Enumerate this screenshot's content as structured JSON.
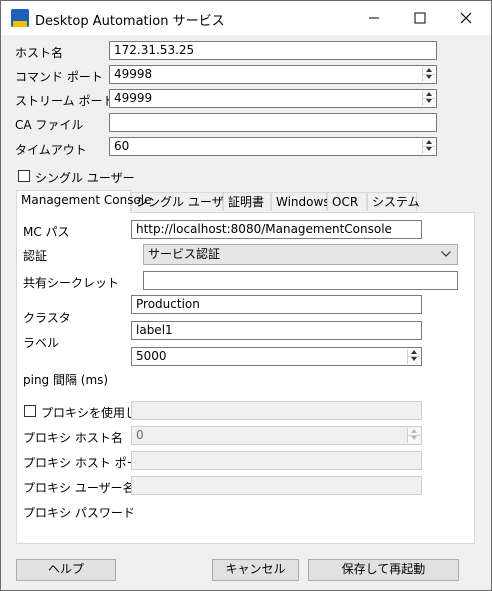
{
  "window": {
    "title": "Desktop Automation サービス"
  },
  "main": {
    "host_label": "ホスト名",
    "host_value": "172.31.53.25",
    "command_port_label": "コマンド ポート",
    "command_port_value": "49998",
    "stream_port_label": "ストリーム ポート",
    "stream_port_value": "49999",
    "ca_file_label": "CA ファイル",
    "ca_file_value": "",
    "timeout_label": "タイムアウト",
    "timeout_value": "60",
    "single_user_label": "シングル ユーザー",
    "single_user_checked": false
  },
  "tabs": [
    {
      "label": "Management Console",
      "active": true
    },
    {
      "label": "シングル ユーザー",
      "active": false
    },
    {
      "label": "証明書",
      "active": false
    },
    {
      "label": "Windows",
      "active": false
    },
    {
      "label": "OCR",
      "active": false
    },
    {
      "label": "システム",
      "active": false
    }
  ],
  "mc": {
    "mc_path_label": "MC パス",
    "mc_path_value": "http://localhost:8080/ManagementConsole",
    "auth_label": "認証",
    "auth_value": "サービス認証",
    "shared_secret_label": "共有シークレット",
    "shared_secret_value": "",
    "cluster_label": "クラスタ",
    "cluster_value": "Production",
    "label_label": "ラベル",
    "label_value": "label1",
    "ping_label": "ping 間隔 (ms)",
    "ping_value": "5000",
    "proxy_use_label": "プロキシを使用して",
    "proxy_use_checked": false,
    "proxy_use_value": "",
    "proxy_host_label": "プロキシ ホスト名",
    "proxy_host_value": "0",
    "proxy_port_label": "プロキシ ホスト ポート",
    "proxy_port_value": "",
    "proxy_user_label": "プロキシ ユーザー名",
    "proxy_user_value": "",
    "proxy_password_label": "プロキシ パスワード"
  },
  "buttons": {
    "help": "ヘルプ",
    "cancel": "キャンセル",
    "save_restart": "保存して再起動"
  }
}
